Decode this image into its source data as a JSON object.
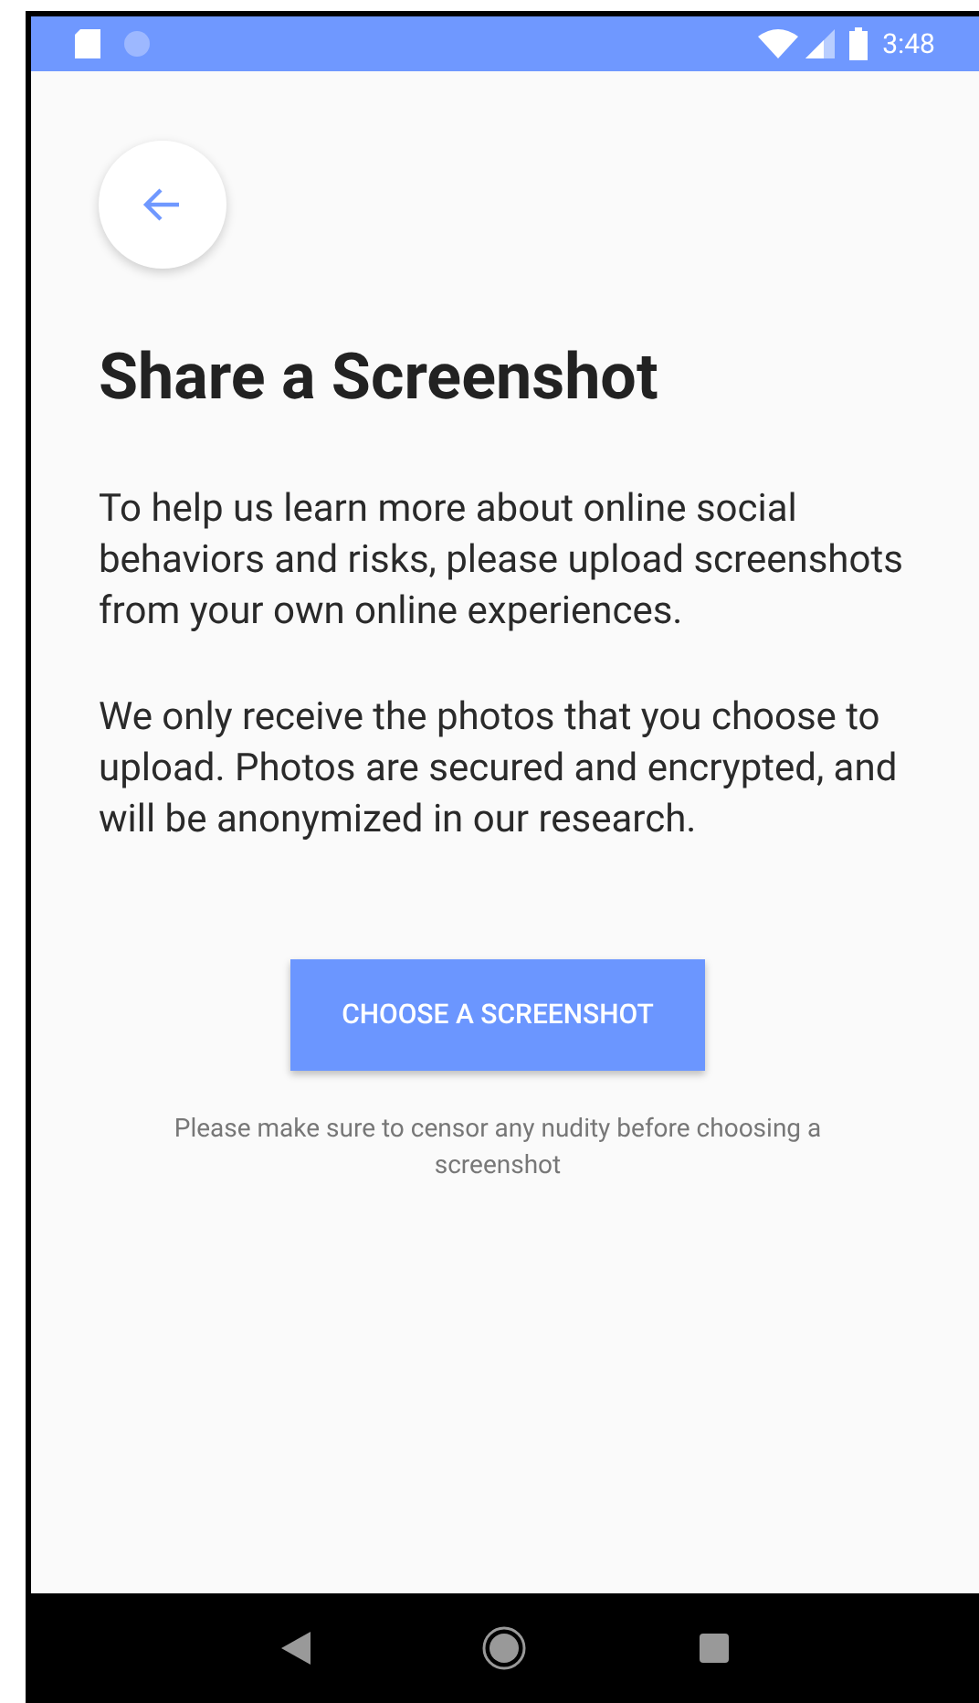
{
  "status_bar": {
    "time": "3:48"
  },
  "title": "Share a Screenshot",
  "paragraphs": [
    "To help us learn more about online social behaviors and risks, please upload screenshots from your own online experiences.",
    "We only receive the photos that you choose to upload. Photos are secured and encrypted, and will be anonymized in our research."
  ],
  "button": "CHOOSE A SCREENSHOT",
  "note": "Please make sure to censor any nudity before choosing a screenshot"
}
